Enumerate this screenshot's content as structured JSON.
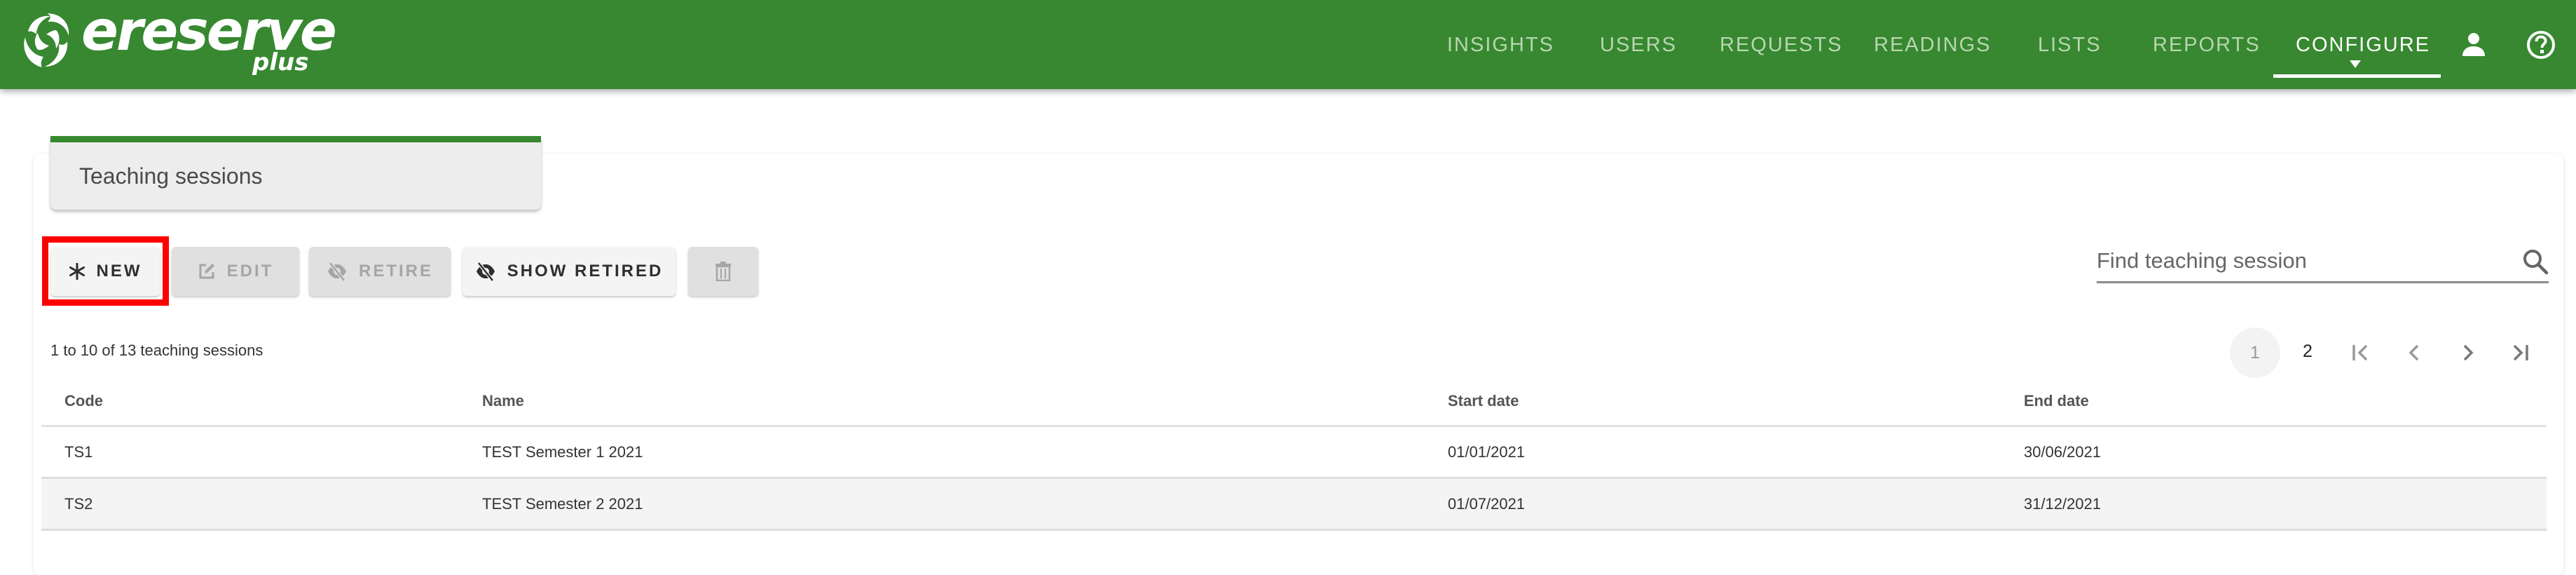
{
  "app": {
    "logo_text": "ereserve",
    "logo_subtext": "plus",
    "brand_color": "#378830"
  },
  "nav": {
    "items": [
      {
        "label": "INSIGHTS",
        "active": false
      },
      {
        "label": "USERS",
        "active": false
      },
      {
        "label": "REQUESTS",
        "active": false
      },
      {
        "label": "READINGS",
        "active": false
      },
      {
        "label": "LISTS",
        "active": false
      },
      {
        "label": "REPORTS",
        "active": false
      },
      {
        "label": "CONFIGURE",
        "active": true
      }
    ],
    "icons": [
      "user-icon",
      "help-icon"
    ]
  },
  "page": {
    "title": "Teaching sessions"
  },
  "toolbar": {
    "new_label": "NEW",
    "edit_label": "EDIT",
    "retire_label": "RETIRE",
    "show_retired_label": "SHOW RETIRED",
    "buttons_state": {
      "new": "enabled",
      "edit": "disabled",
      "retire": "disabled",
      "show_retired": "enabled",
      "delete": "disabled"
    }
  },
  "search": {
    "placeholder": "Find teaching session",
    "value": ""
  },
  "results": {
    "count_text": "1 to 10 of 13 teaching sessions"
  },
  "pagination": {
    "pages": [
      "1",
      "2"
    ],
    "current_page": "1"
  },
  "table": {
    "columns": [
      "Code",
      "Name",
      "Start date",
      "End date"
    ],
    "rows": [
      {
        "code": "TS1",
        "name": "TEST Semester 1 2021",
        "start_date": "01/01/2021",
        "end_date": "30/06/2021"
      },
      {
        "code": "TS2",
        "name": "TEST Semester 2 2021",
        "start_date": "01/07/2021",
        "end_date": "31/12/2021"
      }
    ]
  }
}
